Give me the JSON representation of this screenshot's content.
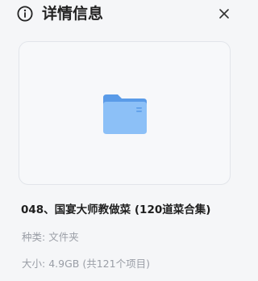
{
  "header": {
    "title": "详情信息",
    "info_icon": "info-circle-icon",
    "close_icon": "close-icon"
  },
  "preview": {
    "icon": "folder-icon",
    "folder_color": "#7fb6f5"
  },
  "file": {
    "name": "048、国宴大师教做菜 (120道菜合集)",
    "type_label": "种类:",
    "type_value": "文件夹",
    "size_label": "大小:",
    "size_value": "4.9GB",
    "count_text": "(共121个项目)"
  }
}
